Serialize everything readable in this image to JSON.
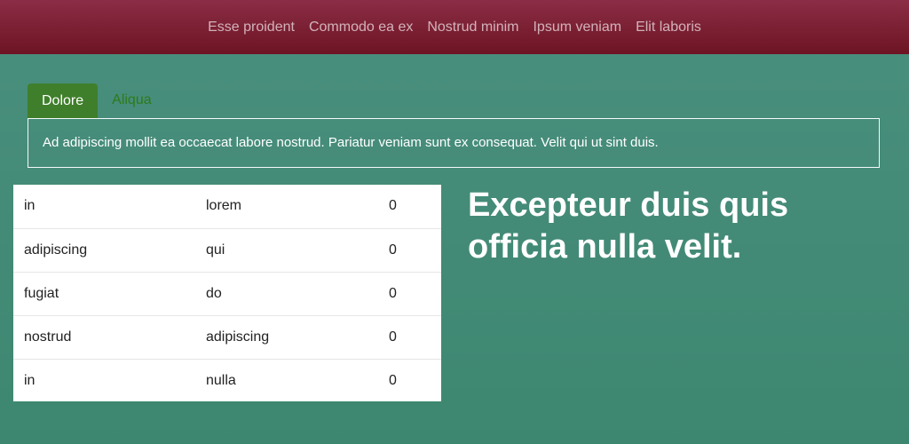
{
  "nav": {
    "items": [
      "Esse proident",
      "Commodo ea ex",
      "Nostrud minim",
      "Ipsum veniam",
      "Elit laboris"
    ]
  },
  "tabs": [
    {
      "label": "Dolore",
      "active": true
    },
    {
      "label": "Aliqua",
      "active": false
    }
  ],
  "tab_panel": {
    "text": "Ad adipiscing mollit ea occaecat labore nostrud. Pariatur veniam sunt ex consequat. Velit qui ut sint duis."
  },
  "table": {
    "rows": [
      [
        "in",
        "lorem",
        "0"
      ],
      [
        "adipiscing",
        "qui",
        "0"
      ],
      [
        "fugiat",
        "do",
        "0"
      ],
      [
        "nostrud",
        "adipiscing",
        "0"
      ],
      [
        "in",
        "nulla",
        "0"
      ]
    ]
  },
  "headline": "Excepteur duis quis officia nulla velit.",
  "colors": {
    "topbar_start": "#8b2d46",
    "topbar_end": "#6d1423",
    "background_start": "#4a8f7e",
    "background_end": "#3d8770",
    "tab_active": "#3f7f2b",
    "tab_inactive_text": "#2e7a1a"
  }
}
